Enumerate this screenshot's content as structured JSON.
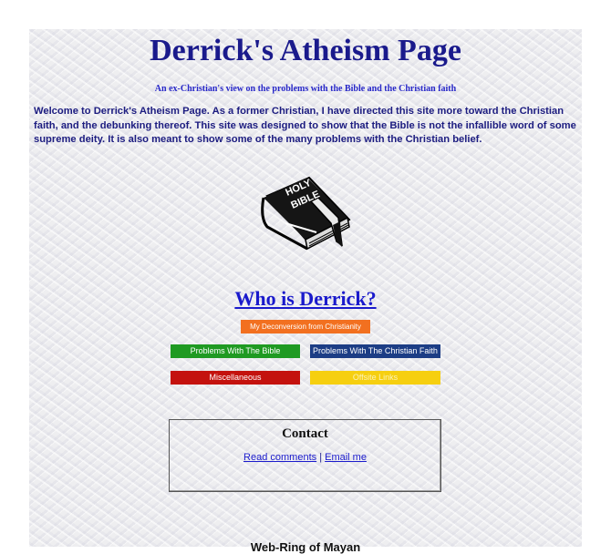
{
  "header": {
    "title": "Derrick's Atheism Page",
    "subtitle": "An ex-Christian's view on the problems with the Bible and the Christian faith"
  },
  "intro": {
    "text": "Welcome to Derrick's Atheism Page.  As a former Christian, I have directed this site more toward the Christian faith, and the debunking thereof.  This site was designed to show that the Bible is not the infallible word of some supreme deity. It is also meant to show some of the many problems with the Christian belief."
  },
  "image": {
    "name": "holy-bible-icon",
    "label_line1": "HOLY",
    "label_line2": "BIBLE"
  },
  "who_link": "Who is Derrick?",
  "nav": {
    "deconversion": "My Deconversion from Christianity",
    "problems_bible": "Problems With The Bible",
    "problems_faith": "Problems With The Christian Faith",
    "misc": "Miscellaneous",
    "offsite": "Offsite Links"
  },
  "nav_colors": {
    "deconversion": "#f27020",
    "problems_bible": "#1f9a22",
    "problems_faith": "#1c3d85",
    "misc": "#c4120e",
    "offsite": "#f6cf10"
  },
  "contact": {
    "title": "Contact",
    "read_comments": "Read comments",
    "separator": "|",
    "email": "Email me"
  },
  "footer": {
    "webring_title": "Web-Ring of Mayan"
  }
}
